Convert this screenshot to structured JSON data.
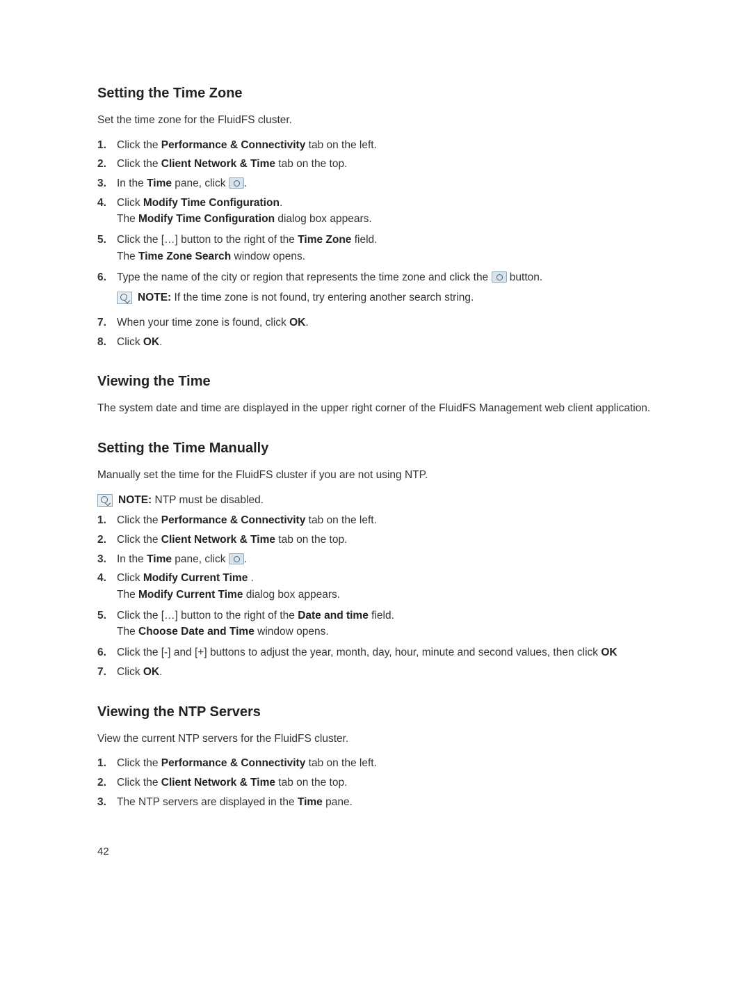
{
  "pageNumber": "42",
  "s1": {
    "heading": "Setting the Time Zone",
    "intro": "Set the time zone for the FluidFS cluster.",
    "step1_a": "Click the ",
    "step1_b": "Performance & Connectivity",
    "step1_c": " tab on the left.",
    "step2_a": "Click the ",
    "step2_b": "Client Network & Time",
    "step2_c": " tab on the top.",
    "step3_a": "In the ",
    "step3_b": "Time",
    "step3_c": " pane, click ",
    "step3_d": ".",
    "step4_a": "Click ",
    "step4_b": "Modify Time Configuration",
    "step4_c": ".",
    "step4_l2a": "The ",
    "step4_l2b": "Modify Time Configuration",
    "step4_l2c": " dialog box appears.",
    "step5_a": "Click the […] button to the right of the ",
    "step5_b": "Time Zone",
    "step5_c": " field.",
    "step5_l2a": "The ",
    "step5_l2b": "Time Zone Search",
    "step5_l2c": " window opens.",
    "step6_a": "Type the name of the city or region that represents the time zone and click the",
    "step6_b": " button.",
    "step6_note_a": "NOTE:",
    "step6_note_b": " If the time zone is not found, try entering another search string.",
    "step7_a": "When your time zone is found, click ",
    "step7_b": "OK",
    "step7_c": ".",
    "step8_a": "Click ",
    "step8_b": "OK",
    "step8_c": "."
  },
  "s2": {
    "heading": "Viewing the Time",
    "intro": "The system date and time are displayed in the upper right corner of the FluidFS Management web client application."
  },
  "s3": {
    "heading": "Setting the Time Manually",
    "intro": "Manually set the time for the FluidFS cluster if you are not using NTP.",
    "note_a": "NOTE:",
    "note_b": " NTP must be disabled.",
    "step1_a": "Click the ",
    "step1_b": "Performance & Connectivity",
    "step1_c": " tab on the left.",
    "step2_a": "Click the ",
    "step2_b": "Client Network & Time",
    "step2_c": " tab on the top.",
    "step3_a": "In the ",
    "step3_b": "Time",
    "step3_c": " pane, click ",
    "step3_d": ".",
    "step4_a": "Click ",
    "step4_b": "Modify Current Time",
    "step4_c": " .",
    "step4_l2a": "The ",
    "step4_l2b": "Modify Current Time",
    "step4_l2c": " dialog box appears.",
    "step5_a": "Click the […] button to the right of the ",
    "step5_b": "Date and time",
    "step5_c": " field.",
    "step5_l2a": "The ",
    "step5_l2b": "Choose Date and Time",
    "step5_l2c": " window opens.",
    "step6_a": "Click the [-] and [+] buttons to adjust the year, month, day, hour, minute and second values, then click ",
    "step6_b": "OK",
    "step7_a": "Click ",
    "step7_b": "OK",
    "step7_c": "."
  },
  "s4": {
    "heading": "Viewing the NTP Servers",
    "intro": "View the current NTP servers for the FluidFS cluster.",
    "step1_a": "Click the ",
    "step1_b": "Performance & Connectivity",
    "step1_c": " tab on the left.",
    "step2_a": "Click the ",
    "step2_b": "Client Network & Time",
    "step2_c": " tab on the top.",
    "step3_a": "The NTP servers are displayed in the ",
    "step3_b": "Time",
    "step3_c": " pane."
  },
  "nums": {
    "n1": "1.",
    "n2": "2.",
    "n3": "3.",
    "n4": "4.",
    "n5": "5.",
    "n6": "6.",
    "n7": "7.",
    "n8": "8."
  }
}
